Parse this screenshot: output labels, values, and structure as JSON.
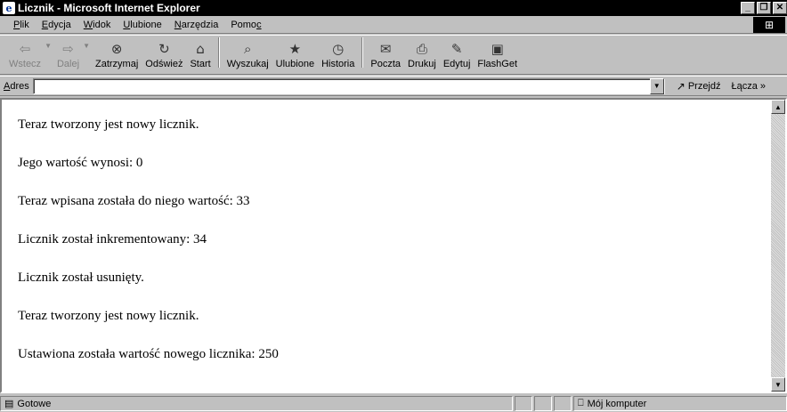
{
  "window": {
    "title": "Licznik - Microsoft Internet Explorer"
  },
  "menu": [
    {
      "label": "Plik",
      "accel": "P",
      "rest": "lik"
    },
    {
      "label": "Edycja",
      "accel": "E",
      "rest": "dycja"
    },
    {
      "label": "Widok",
      "accel": "W",
      "rest": "idok"
    },
    {
      "label": "Ulubione",
      "accel": "U",
      "rest": "lubione"
    },
    {
      "label": "Narzędzia",
      "accel": "N",
      "rest": "arzędzia"
    },
    {
      "label": "Pomoc",
      "pre": "Pomo",
      "accel": "c"
    }
  ],
  "toolbar": {
    "back": {
      "label": "Wstecz",
      "icon": "back-arrow-icon"
    },
    "forward": {
      "label": "Dalej",
      "icon": "forward-arrow-icon"
    },
    "stop": {
      "label": "Zatrzymaj",
      "icon": "stop-icon"
    },
    "refresh": {
      "label": "Odśwież",
      "icon": "refresh-icon"
    },
    "home": {
      "label": "Start",
      "icon": "home-icon"
    },
    "search": {
      "label": "Wyszukaj",
      "icon": "search-icon"
    },
    "favorites": {
      "label": "Ulubione",
      "icon": "favorites-icon"
    },
    "history": {
      "label": "Historia",
      "icon": "history-icon"
    },
    "mail": {
      "label": "Poczta",
      "icon": "mail-icon"
    },
    "print": {
      "label": "Drukuj",
      "icon": "print-icon"
    },
    "edit": {
      "label": "Edytuj",
      "icon": "edit-icon"
    },
    "flashget": {
      "label": "FlashGet",
      "icon": "flashget-icon"
    }
  },
  "address": {
    "label": "Adres",
    "value": "",
    "go_label": "Przejdź",
    "links_label": "Łącza"
  },
  "content": {
    "lines": [
      "Teraz tworzony jest nowy licznik.",
      "Jego wartość wynosi: 0",
      "Teraz wpisana została do niego wartość: 33",
      "Licznik został inkrementowany: 34",
      "Licznik został usunięty.",
      "Teraz tworzony jest nowy licznik.",
      "Ustawiona została wartość nowego licznika: 250"
    ]
  },
  "status": {
    "text": "Gotowe",
    "zone": "Mój komputer"
  }
}
